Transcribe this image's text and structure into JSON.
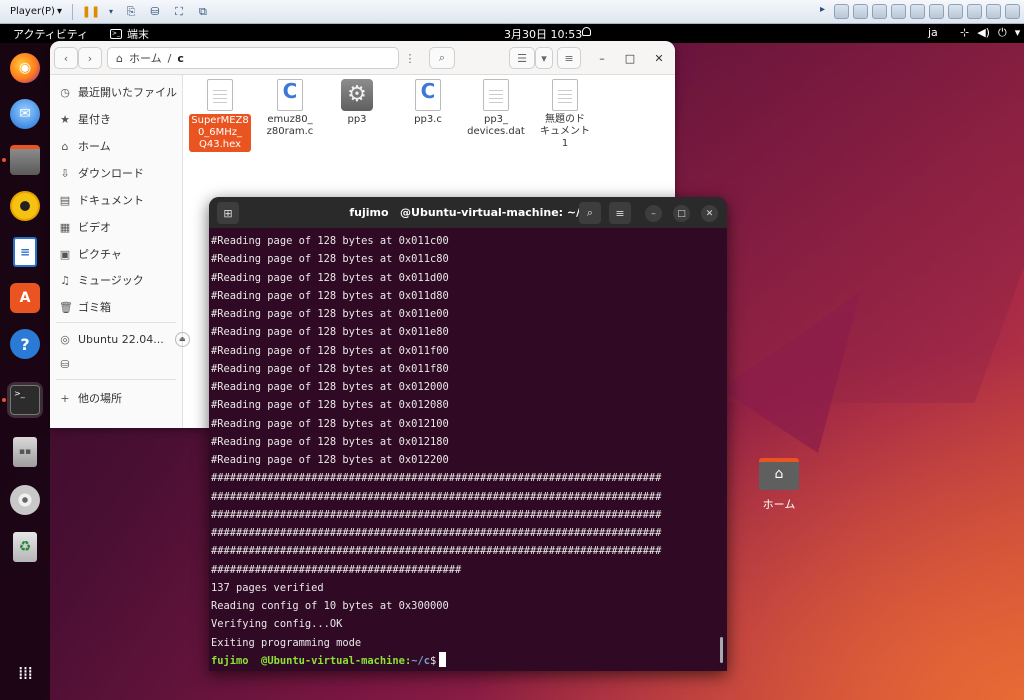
{
  "vmware": {
    "player_label": "Player(P)"
  },
  "topbar": {
    "activities": "アクティビティ",
    "app_name": "端末",
    "clock": "3月30日  10:53",
    "lang": "ja"
  },
  "dock": {
    "items": [
      "firefox-icon",
      "thunderbird-icon",
      "files-icon",
      "rhythmbox-icon",
      "writer-icon",
      "software-icon",
      "help-icon",
      "terminal-icon",
      "disk-icon",
      "optical-drive-icon",
      "trash-icon",
      "show-apps-icon"
    ]
  },
  "files": {
    "path_home": "ホーム",
    "path_sep": "/",
    "path_current": "c",
    "sidebar": {
      "recent": "最近開いたファイル",
      "starred": "星付き",
      "home": "ホーム",
      "downloads": "ダウンロード",
      "documents": "ドキュメント",
      "videos": "ビデオ",
      "pictures": "ピクチャ",
      "music": "ミュージック",
      "trash": "ゴミ箱",
      "volume": "Ubuntu 22.04...",
      "other": "他の場所"
    },
    "items": [
      {
        "name": "SuperMEZ80_6MHz_Q43.hex",
        "l1": "SuperMEZ8",
        "l2": "0_6MHz_",
        "l3": "Q43.hex"
      },
      {
        "name": "emuz80_z80ram.c",
        "l1": "emuz80_",
        "l2": "z80ram.c",
        "l3": ""
      },
      {
        "name": "pp3",
        "l1": "pp3",
        "l2": "",
        "l3": ""
      },
      {
        "name": "pp3.c",
        "l1": "pp3.c",
        "l2": "",
        "l3": ""
      },
      {
        "name": "pp3_devices.dat",
        "l1": "pp3_",
        "l2": "devices.dat",
        "l3": ""
      },
      {
        "name": "無題のドキュメント1",
        "l1": "無題のド",
        "l2": "キュメント",
        "l3": "1"
      }
    ]
  },
  "terminal": {
    "title_user": "fujimo",
    "title_host": "@Ubuntu-virtual-machine: ~/c",
    "lines": [
      "#Reading page of 128 bytes at 0x011c00",
      "#Reading page of 128 bytes at 0x011c80",
      "#Reading page of 128 bytes at 0x011d00",
      "#Reading page of 128 bytes at 0x011d80",
      "#Reading page of 128 bytes at 0x011e00",
      "#Reading page of 128 bytes at 0x011e80",
      "#Reading page of 128 bytes at 0x011f00",
      "#Reading page of 128 bytes at 0x011f80",
      "#Reading page of 128 bytes at 0x012000",
      "#Reading page of 128 bytes at 0x012080",
      "#Reading page of 128 bytes at 0x012100",
      "#Reading page of 128 bytes at 0x012180",
      "#Reading page of 128 bytes at 0x012200",
      "########################################################################",
      "########################################################################",
      "########################################################################",
      "########################################################################",
      "########################################################################",
      "########################################",
      "137 pages verified",
      "Reading config of 10 bytes at 0x300000",
      "Verifying config...OK",
      "Exiting programming mode"
    ],
    "prompt_user": "fujimo",
    "prompt_host": "  @Ubuntu-virtual-machine:",
    "prompt_path": "~/c",
    "prompt_symbol": "$"
  },
  "desktop": {
    "home_label": "ホーム"
  }
}
